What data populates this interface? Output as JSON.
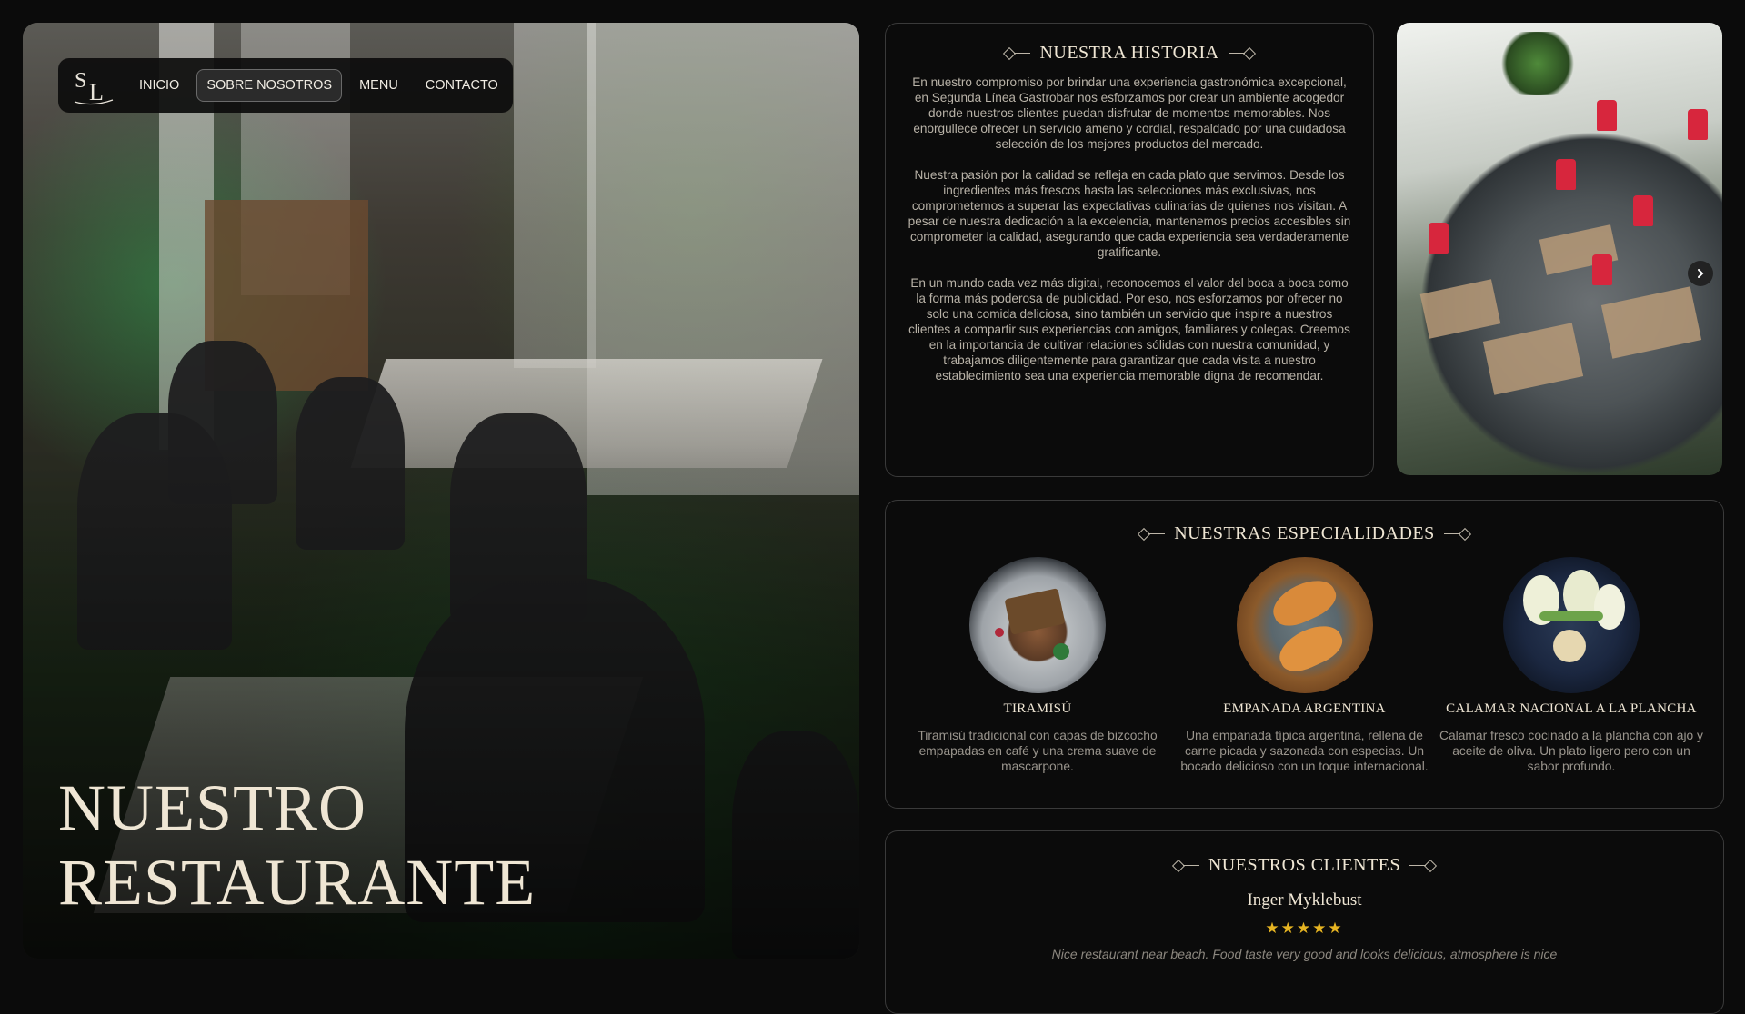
{
  "brand": {
    "logo_text": "SL"
  },
  "nav": {
    "items": [
      {
        "label": "INICIO"
      },
      {
        "label": "SOBRE NOSOTROS",
        "active": true
      },
      {
        "label": "MENU"
      },
      {
        "label": "CONTACTO"
      }
    ]
  },
  "hero": {
    "title_line1": "NUESTRO",
    "title_line2": "RESTAURANTE"
  },
  "history": {
    "heading": "NUESTRA HISTORIA",
    "paragraphs": [
      "En nuestro compromiso por brindar una experiencia gastronómica excepcional, en Segunda Línea Gastrobar nos esforzamos por crear un ambiente acogedor donde nuestros clientes puedan disfrutar de momentos memorables. Nos enorgullece ofrecer un servicio ameno y cordial, respaldado por una cuidadosa selección de los mejores productos del mercado.",
      "Nuestra pasión por la calidad se refleja en cada plato que servimos. Desde los ingredientes más frescos hasta las selecciones más exclusivas, nos comprometemos a superar las expectativas culinarias de quienes nos visitan. A pesar de nuestra dedicación a la excelencia, mantenemos precios accesibles sin comprometer la calidad, asegurando que cada experiencia sea verdaderamente gratificante.",
      "En un mundo cada vez más digital, reconocemos el valor del boca a boca como la forma más poderosa de publicidad. Por eso, nos esforzamos por ofrecer no solo una comida deliciosa, sino también un servicio que inspire a nuestros clientes a compartir sus experiencias con amigos, familiares y colegas. Creemos en la importancia de cultivar relaciones sólidas con nuestra comunidad, y trabajamos diligentemente para garantizar que cada visita a nuestro establecimiento sea una experiencia memorable digna de recomendar."
    ]
  },
  "specials": {
    "heading": "NUESTRAS ESPECIALIDADES",
    "dishes": [
      {
        "name": "TIRAMISÚ",
        "description": "Tiramisú tradicional con capas de bizcocho empapadas en café y una crema suave de mascarpone."
      },
      {
        "name": "EMPANADA ARGENTINA",
        "description": "Una empanada típica argentina, rellena de carne picada y sazonada con especias. Un bocado delicioso con un toque internacional."
      },
      {
        "name": "CALAMAR NACIONAL A LA PLANCHA",
        "description": "Calamar fresco cocinado a la plancha con ajo y aceite de oliva. Un plato ligero pero con un sabor profundo."
      }
    ]
  },
  "clients": {
    "heading": "NUESTROS CLIENTES",
    "review": {
      "name": "Inger Myklebust",
      "stars": "★★★★★",
      "rating": 5,
      "text": "Nice restaurant near beach. Food taste very good and looks delicious, atmosphere is nice"
    }
  },
  "icons": {
    "carousel_next": "chevron-right-icon",
    "ornament": "diamond-line-ornament-icon"
  },
  "colors": {
    "background": "#0b0b0b",
    "cream": "#efe6d4",
    "star": "#e6b422",
    "border": "#3a3a3a"
  }
}
